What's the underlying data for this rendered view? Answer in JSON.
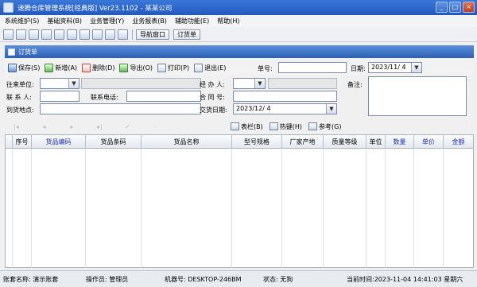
{
  "window": {
    "title": "速腾仓库管理系统[经典版] Ver23.1102  - 某某公司",
    "controls": [
      "minimize",
      "maximize",
      "close"
    ]
  },
  "menubar": {
    "items": [
      "系统维护(S)",
      "基础资料(B)",
      "业务管理(Y)",
      "业务报表(B)",
      "辅助功能(E)",
      "帮助(H)"
    ]
  },
  "toolbar": {
    "icons": [
      "grid-icon",
      "table-icon",
      "copy-icon",
      "transfer-icon",
      "report-icon",
      "disk-icon",
      "save-icon",
      "print-icon",
      "help-icon",
      "exit-icon"
    ],
    "nav_window_label": "导航窗口",
    "order_label": "订货单"
  },
  "document": {
    "title": "订货单"
  },
  "actions": {
    "save": "保存(S)",
    "add": "新增(A)",
    "delete": "删除(D)",
    "export": "导出(O)",
    "print": "打印(P)",
    "exit": "退出(E)"
  },
  "form": {
    "doc_no_label": "单号:",
    "doc_no_value": "",
    "date_label": "日期:",
    "date_value": "2023/11/ 4",
    "partner_label": "往来单位:",
    "partner_value": "",
    "partner_name_value": "",
    "handler_label": "经 办 人:",
    "handler_value": "",
    "handler_name_value": "",
    "remark_label": "备注:",
    "contact_label": "联 系 人:",
    "contact_value": "",
    "phone_label": "联系电话:",
    "phone_value": "",
    "contract_label": "合 同 号:",
    "contract_value": "",
    "address_label": "到货地点:",
    "address_value": "",
    "delivery_date_label": "交货日期:",
    "delivery_date_value": "2023/12/ 4"
  },
  "navbar": {
    "icons": [
      "first-icon",
      "prev-icon",
      "next-icon",
      "last-icon",
      "refresh-icon",
      "cancel-icon"
    ],
    "table_btn": "表栏(B)",
    "hotkey_btn": "热键(H)",
    "ref_btn": "参考(G)"
  },
  "grid": {
    "columns": [
      {
        "label": "序号",
        "blue": false
      },
      {
        "label": "货品编码",
        "blue": true
      },
      {
        "label": "货品条码",
        "blue": false
      },
      {
        "label": "货品名称",
        "blue": false
      },
      {
        "label": "型号规格",
        "blue": false
      },
      {
        "label": "厂家产地",
        "blue": false
      },
      {
        "label": "质量等级",
        "blue": false
      },
      {
        "label": "单位",
        "blue": false
      },
      {
        "label": "数量",
        "blue": true
      },
      {
        "label": "单价",
        "blue": true
      },
      {
        "label": "金额",
        "blue": true
      }
    ],
    "rows": []
  },
  "status": {
    "account": "账套名称: 演示账套",
    "operator": "操作员: 管理员",
    "machine": "机器号: DESKTOP-246BM",
    "state": "状态: 无狗",
    "time": "当前时间:2023-11-04 14:41:03 星期六"
  }
}
